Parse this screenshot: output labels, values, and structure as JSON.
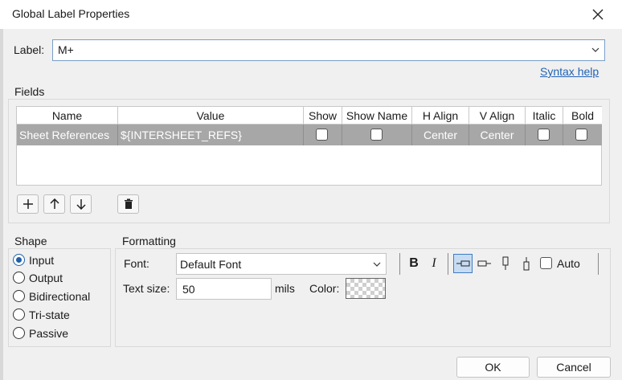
{
  "window": {
    "title": "Global Label Properties"
  },
  "label": {
    "caption": "Label:",
    "value": "M+"
  },
  "syntax_help": "Syntax help",
  "fields": {
    "group_title": "Fields",
    "columns": [
      "Name",
      "Value",
      "Show",
      "Show Name",
      "H Align",
      "V Align",
      "Italic",
      "Bold"
    ],
    "rows": [
      {
        "name": "Sheet References",
        "value": "${INTERSHEET_REFS}",
        "show": false,
        "show_name": false,
        "h_align": "Center",
        "v_align": "Center",
        "italic": false,
        "bold": false
      }
    ]
  },
  "shape": {
    "group_title": "Shape",
    "options": [
      "Input",
      "Output",
      "Bidirectional",
      "Tri-state",
      "Passive"
    ],
    "selected": "Input"
  },
  "formatting": {
    "group_title": "Formatting",
    "font_label": "Font:",
    "font_value": "Default Font",
    "text_size_label": "Text size:",
    "text_size_value": "50",
    "unit": "mils",
    "color_label": "Color:",
    "auto_label": "Auto",
    "auto_checked": false,
    "bold_glyph": "B",
    "italic_glyph": "I"
  },
  "buttons": {
    "ok": "OK",
    "cancel": "Cancel"
  },
  "colors": {
    "selected_row": "#a7a7a7",
    "accent": "#1f5fa8",
    "link": "#1f63b5"
  }
}
